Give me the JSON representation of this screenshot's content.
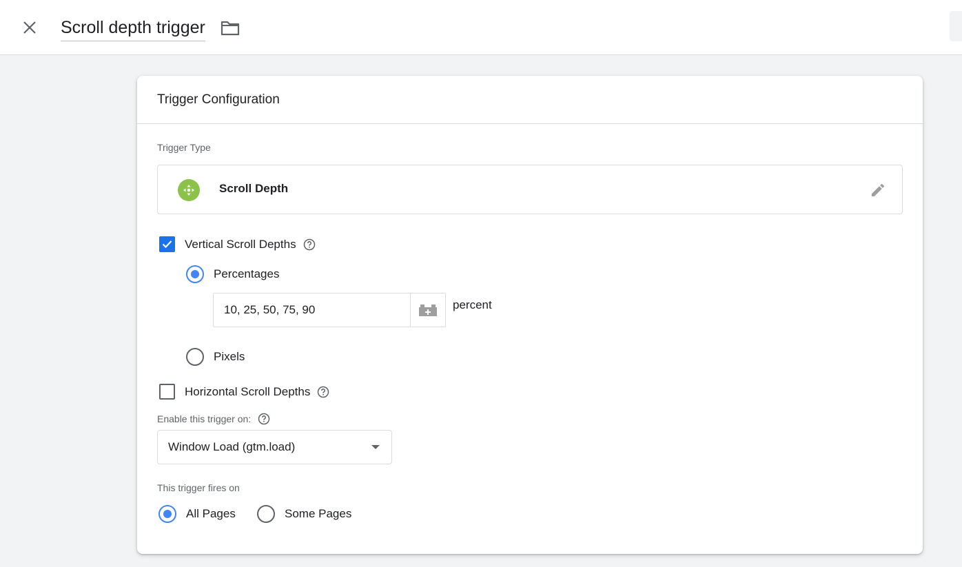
{
  "header": {
    "title": "Scroll depth trigger",
    "close_icon": "close-icon",
    "folder_icon": "folder-icon"
  },
  "card": {
    "title": "Trigger Configuration",
    "trigger_type_label": "Trigger Type",
    "trigger_type": {
      "name": "Scroll Depth",
      "icon": "scroll-depth-icon",
      "icon_color": "#8bc34a",
      "edit_icon": "pencil-icon"
    },
    "vertical": {
      "label": "Vertical Scroll Depths",
      "checked": true,
      "percentages_label": "Percentages",
      "percentages_selected": true,
      "percentages_value": "10, 25, 50, 75, 90",
      "unit": "percent",
      "pixels_label": "Pixels",
      "pixels_selected": false
    },
    "horizontal": {
      "label": "Horizontal Scroll Depths",
      "checked": false
    },
    "enable_on": {
      "label": "Enable this trigger on:",
      "selected": "Window Load (gtm.load)"
    },
    "fires_on": {
      "label": "This trigger fires on",
      "all_pages": "All Pages",
      "all_pages_selected": true,
      "some_pages": "Some Pages",
      "some_pages_selected": false
    }
  },
  "colors": {
    "accent": "#1a73e8",
    "radio": "#4285f4",
    "background": "#f1f3f4"
  }
}
